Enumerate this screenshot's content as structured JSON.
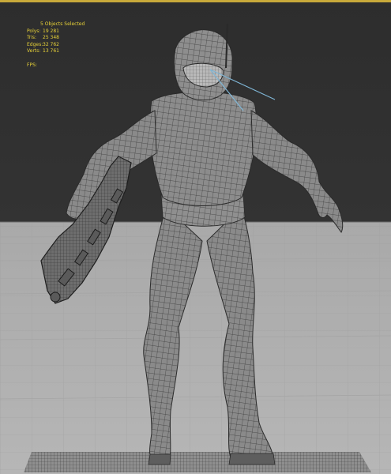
{
  "viewport": {
    "stats": {
      "selection_label": "5 Objects Selected",
      "rows": [
        {
          "label": "Polys:",
          "value": "19 281"
        },
        {
          "label": "Tris:",
          "value": "25 348"
        },
        {
          "label": "Edges:",
          "value": "32 762"
        },
        {
          "label": "Verts:",
          "value": "13 761"
        }
      ],
      "fps_label": "FPS:"
    }
  },
  "colors": {
    "accent_border": "#c8a93a",
    "stats_text": "#e8d238",
    "background_upper": "#2d2d2d",
    "ground": "#b6b6b6",
    "mesh_fill": "#8a8a8a",
    "wire": "#3a3a3a",
    "gizmo": "#7fb6d6"
  }
}
